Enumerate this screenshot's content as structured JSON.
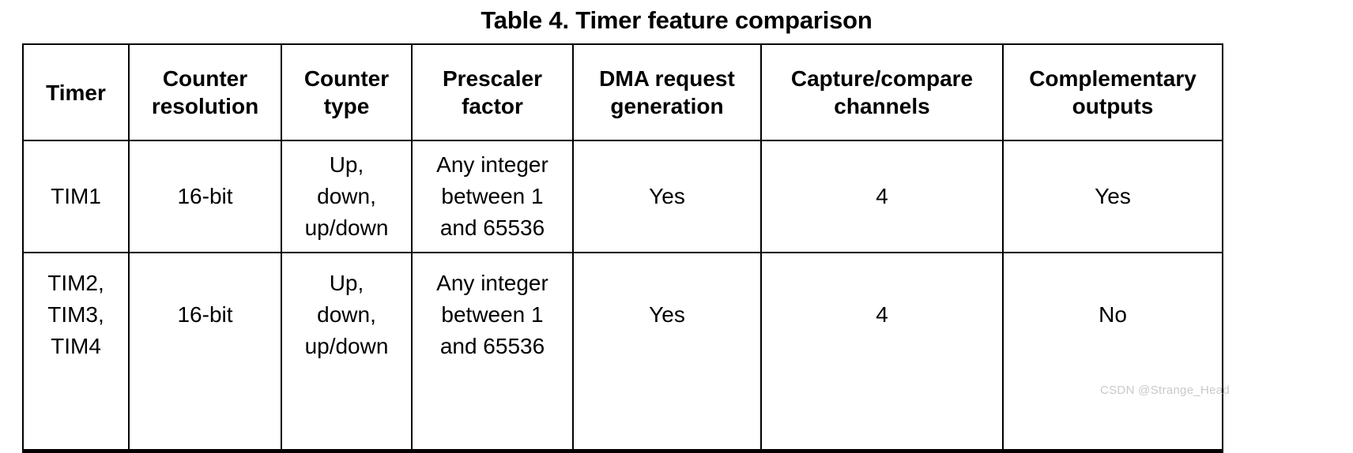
{
  "caption": "Table 4. Timer feature comparison",
  "table": {
    "headers": [
      "Timer",
      "Counter\nresolution",
      "Counter\ntype",
      "Prescaler\nfactor",
      "DMA request\ngeneration",
      "Capture/compare\nchannels",
      "Complementary\noutputs"
    ],
    "rows": [
      {
        "timer": "TIM1",
        "counter_resolution": "16-bit",
        "counter_type": "Up,\ndown,\nup/down",
        "prescaler_factor": "Any integer\nbetween 1\nand 65536",
        "dma_request_generation": "Yes",
        "capture_compare_channels": "4",
        "complementary_outputs": "Yes"
      },
      {
        "timer": "TIM2,\nTIM3,\nTIM4",
        "counter_resolution": "16-bit",
        "counter_type": "Up,\ndown,\nup/down",
        "prescaler_factor": "Any integer\nbetween 1\nand 65536",
        "dma_request_generation": "Yes",
        "capture_compare_channels": "4",
        "complementary_outputs": "No"
      }
    ]
  },
  "watermark": "CSDN @Strange_Head",
  "colors": {
    "text": "#000000",
    "background": "#ffffff",
    "border": "#000000",
    "watermark": "#c9c9c9"
  }
}
